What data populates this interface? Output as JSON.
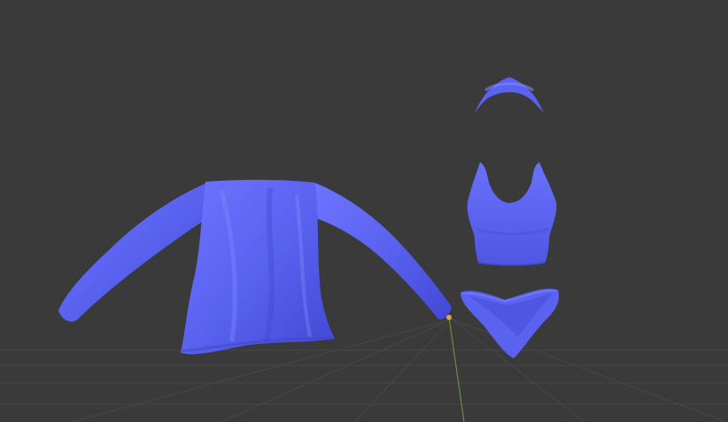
{
  "viewport": {
    "background": "#3a3a3a",
    "grid_color": "#4a4a4a",
    "axis_y_color": "#6f8a3a",
    "cloth_color": "#5a62f0",
    "cloth_shadow": "#3e45c8",
    "cloth_highlight": "#8a90ff"
  },
  "objects": [
    {
      "name": "long-sleeve-shirt"
    },
    {
      "name": "headband"
    },
    {
      "name": "tank-top"
    },
    {
      "name": "bikini-bottom"
    }
  ]
}
